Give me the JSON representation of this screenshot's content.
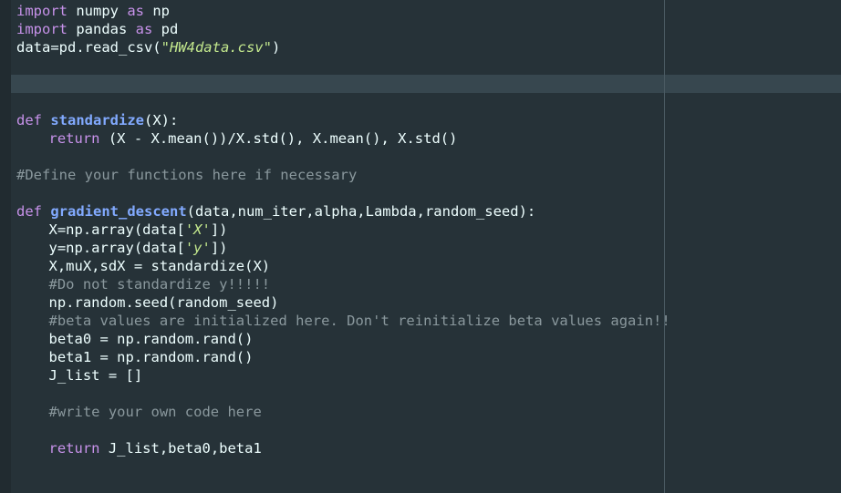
{
  "code": {
    "l1_kw": "import",
    "l1_mid": " numpy ",
    "l1_kw2": "as",
    "l1_end": " np",
    "l2_kw": "import",
    "l2_mid": " pandas ",
    "l2_kw2": "as",
    "l2_end": " pd",
    "l3_pre": "data=pd.read_csv(",
    "l3_str": "\"HW4data.csv\"",
    "l3_post": ")",
    "l7_kw": "def",
    "l7_fn": "standardize",
    "l7_args": "(X):",
    "l8_kw": "return",
    "l8_rest": " (X - X.mean())/X.std(), X.mean(), X.std()",
    "l10_cmt": "#Define your functions here if necessary",
    "l12_kw": "def",
    "l12_fn": "gradient_descent",
    "l12_args": "(data,num_iter,alpha,Lambda,random_seed):",
    "l13_pre": "X=np.array(data[",
    "l13_str": "'X'",
    "l13_post": "])",
    "l14_pre": "y=np.array(data[",
    "l14_str": "'y'",
    "l14_post": "])",
    "l15": "X,muX,sdX = standardize(X)",
    "l16_cmt": "#Do not standardize y!!!!!",
    "l17": "np.random.seed(random_seed)",
    "l18_cmt": "#beta values are initialized here. Don't reinitialize beta values again!!",
    "l19": "beta0 = np.random.rand()",
    "l20": "beta1 = np.random.rand()",
    "l21": "J_list = []",
    "l23_cmt": "#write your own code here",
    "l25_kw": "return",
    "l25_rest": " J_list,beta0,beta1"
  }
}
